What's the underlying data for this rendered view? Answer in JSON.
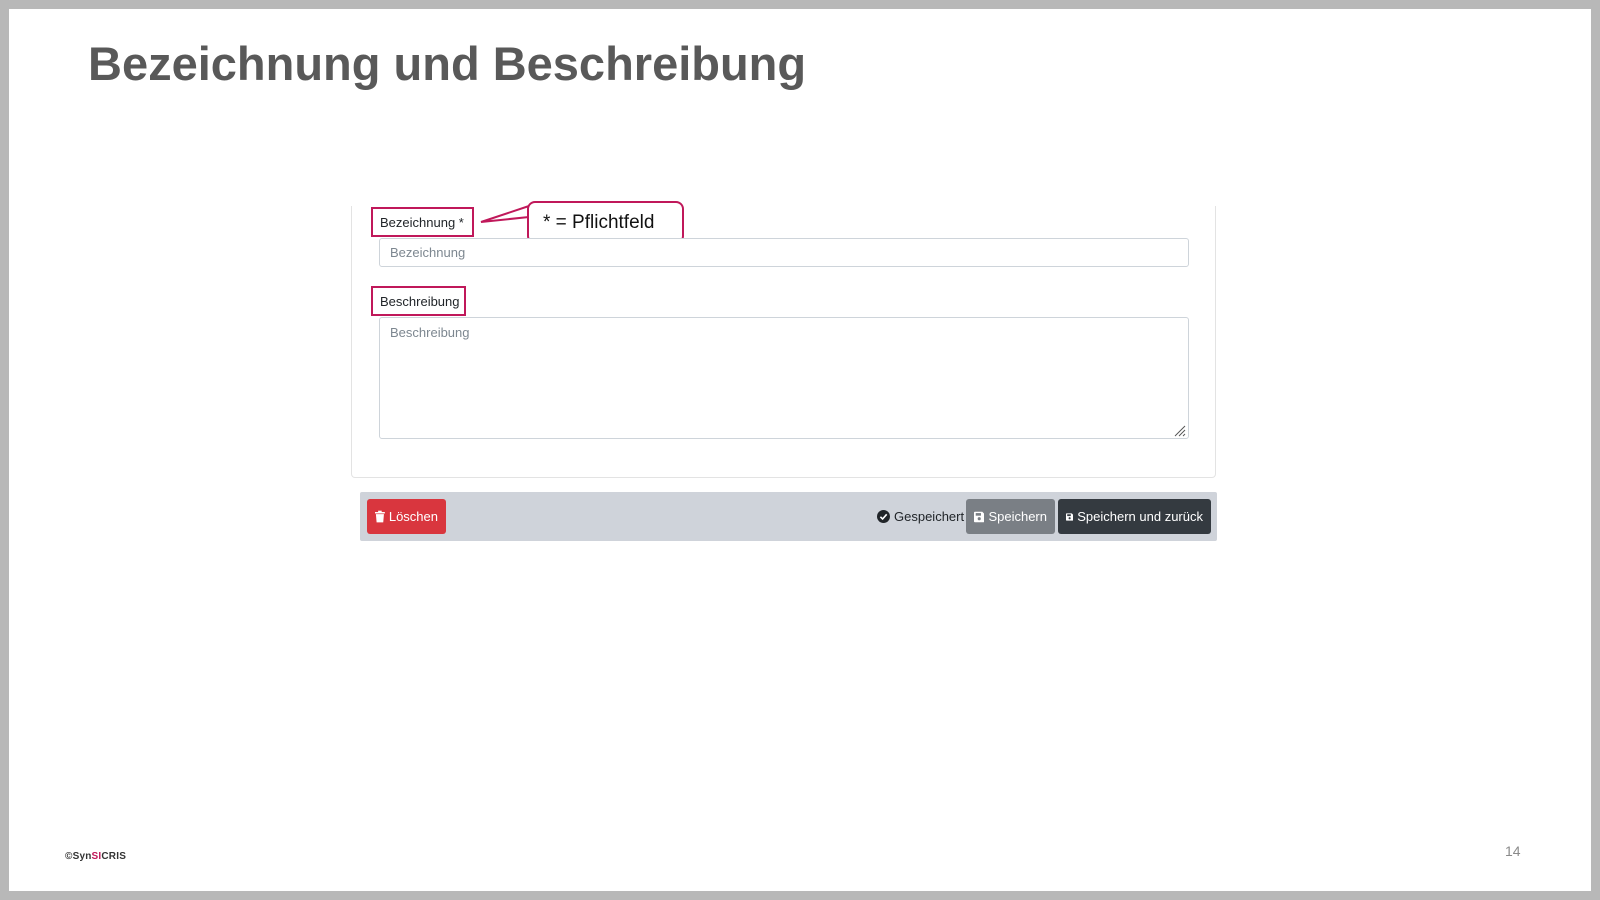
{
  "slide": {
    "title": "Bezeichnung und Beschreibung",
    "page_number": "14"
  },
  "footer": {
    "copyright_symbol": "©",
    "brand_prefix": "Syn",
    "brand_accent": "SI",
    "brand_suffix": "CRIS",
    "accent_color": "#c0185a"
  },
  "form": {
    "name_label": "Bezeichnung *",
    "name_placeholder": "Bezeichnung",
    "name_value": "",
    "description_label": "Beschreibung",
    "description_placeholder": "Beschreibung",
    "description_value": ""
  },
  "callout": {
    "text": "* = Pflichtfeld",
    "highlight_color": "#c0185a"
  },
  "actions": {
    "delete_label": "Löschen",
    "saved_status": "Gespeichert",
    "save_label": "Speichern",
    "save_back_label": "Speichern und zurück",
    "icons": {
      "delete": "trash-icon",
      "saved": "check-circle-icon",
      "save": "floppy-disk-icon",
      "save_back": "floppy-disk-icon"
    },
    "colors": {
      "delete": "#d9363e",
      "save": "#7a7f85",
      "save_back": "#343a40"
    }
  }
}
